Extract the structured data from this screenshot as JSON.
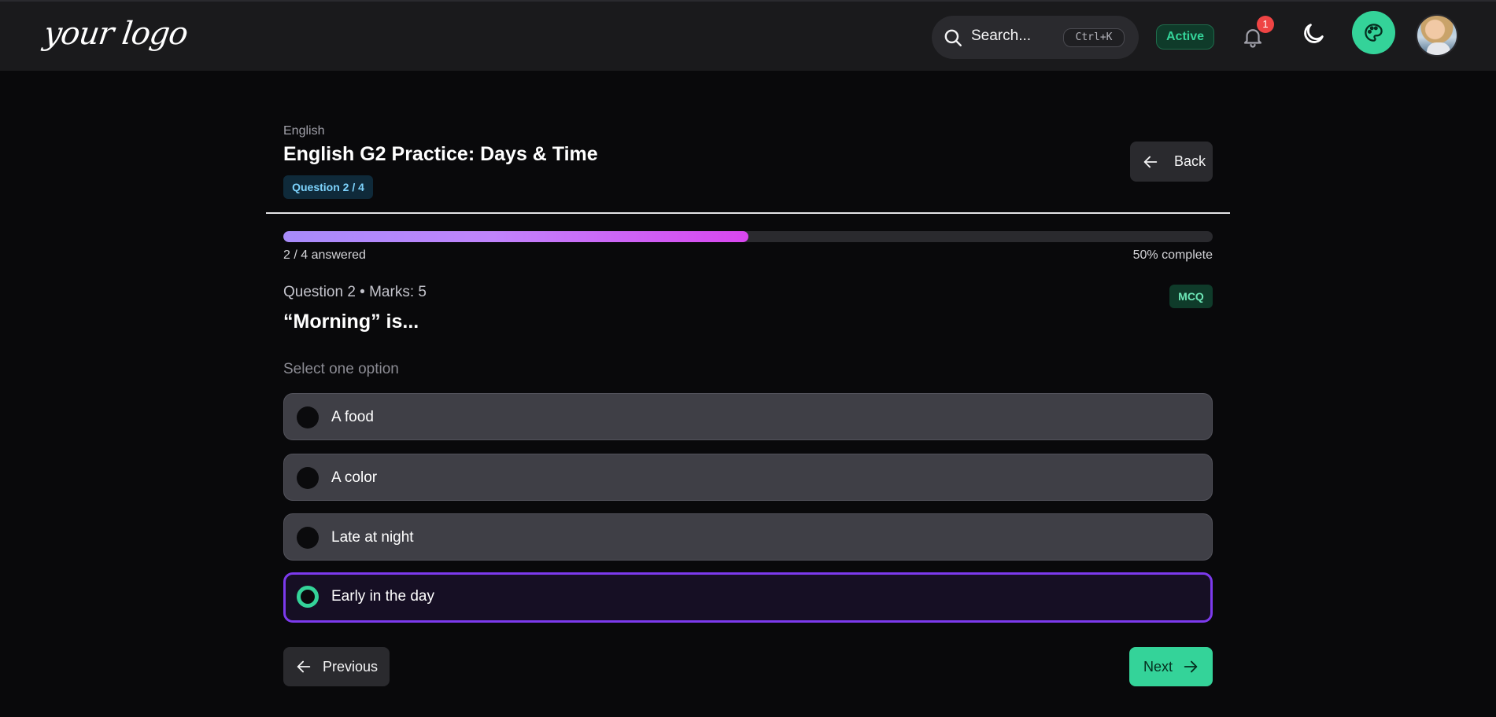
{
  "header": {
    "logo_text": "your logo",
    "search_placeholder": "Search...",
    "search_shortcut": "Ctrl+K",
    "status": "Active",
    "notification_count": "1",
    "icons": [
      "search-icon",
      "bell-icon",
      "moon-icon",
      "palette-icon",
      "avatar"
    ]
  },
  "quiz": {
    "subject": "English",
    "title": "English G2 Practice: Days & Time",
    "question_badge": "Question 2 / 4",
    "back_label": "Back",
    "progress_fraction": 0.5,
    "answered_text": "2 / 4 answered",
    "complete_text": "50% complete"
  },
  "question": {
    "meta": "Question 2 • Marks: 5",
    "type_badge": "MCQ",
    "text": "“Morning” is...",
    "instruction": "Select one option",
    "options": [
      {
        "label": "A food",
        "selected": false
      },
      {
        "label": "A color",
        "selected": false
      },
      {
        "label": "Late at night",
        "selected": false
      },
      {
        "label": "Early in the day",
        "selected": true
      }
    ]
  },
  "nav": {
    "previous_label": "Previous",
    "next_label": "Next"
  },
  "colors": {
    "accent_green": "#34d399",
    "selected_border": "#7c3aed",
    "progress_gradient": [
      "#a78bfa",
      "#d946ef"
    ]
  }
}
